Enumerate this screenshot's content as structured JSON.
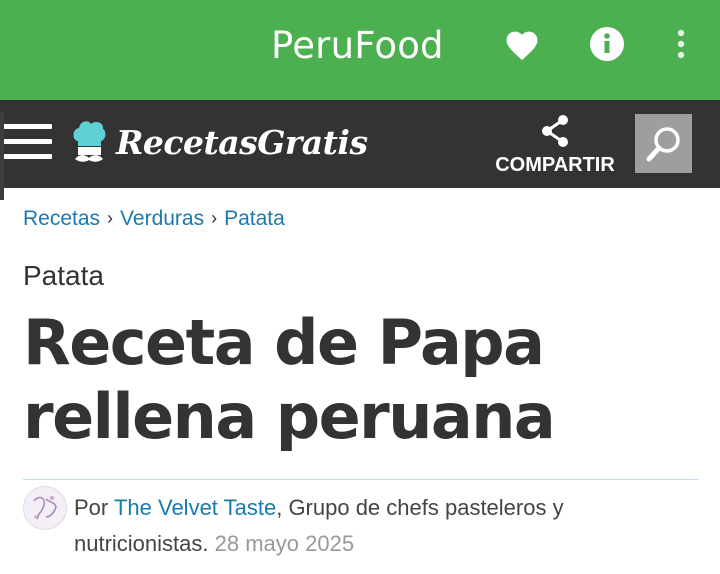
{
  "app": {
    "title": "PeruFood",
    "bar_color": "#4caf50",
    "icons": [
      "heart-icon",
      "info-icon",
      "more-vert-icon"
    ]
  },
  "site": {
    "logo_text": "RecetasGratis",
    "header_color": "#333333",
    "share_label": "COMPARTIR",
    "icons": [
      "menu-icon",
      "chef-icon",
      "share-icon",
      "search-icon"
    ]
  },
  "breadcrumb": {
    "items": [
      "Recetas",
      "Verduras",
      "Patata"
    ],
    "separator": "›",
    "link_color": "#1a7ab0"
  },
  "article": {
    "category": "Patata",
    "title": "Receta de Papa rellena peruana",
    "by_prefix": "Por",
    "author": "The Velvet Taste",
    "author_desc": ", Grupo de chefs pasteleros y nutricionistas.",
    "date": "28 mayo 2025"
  }
}
